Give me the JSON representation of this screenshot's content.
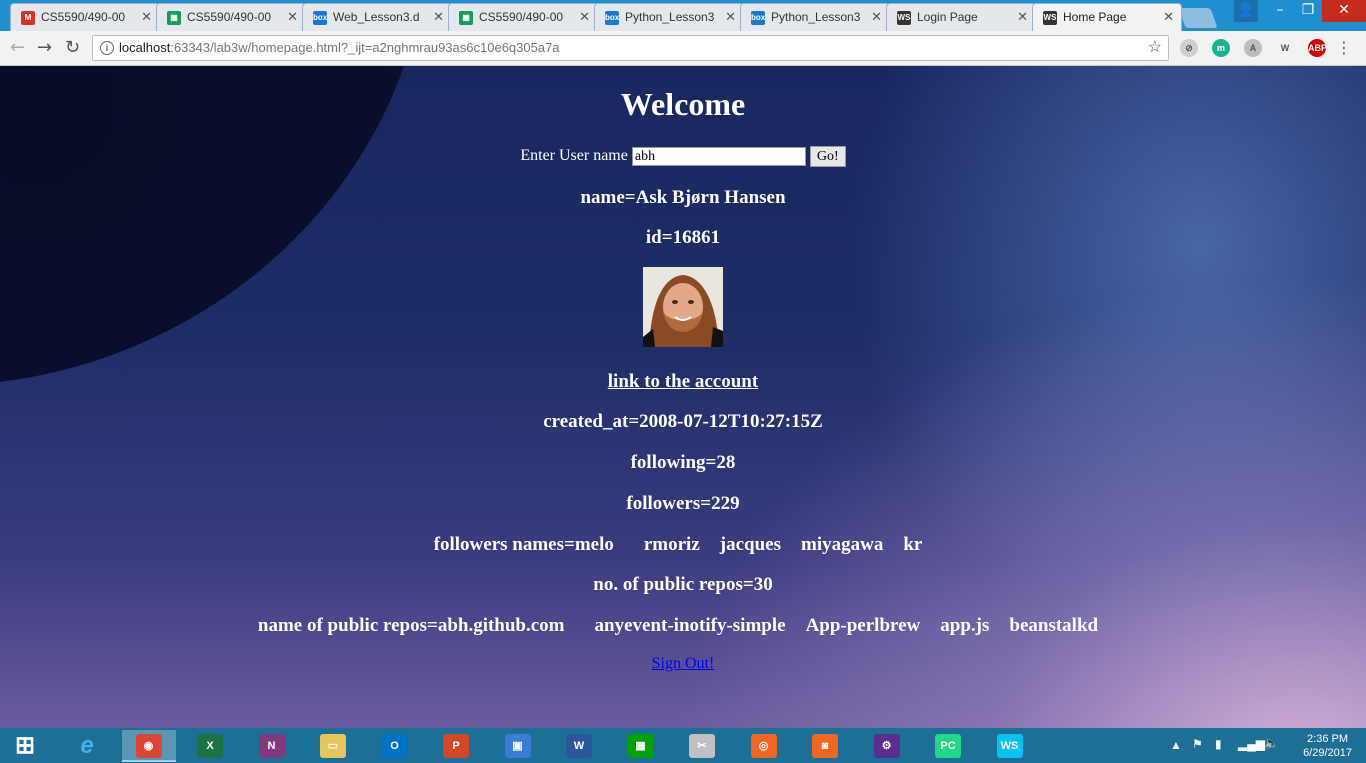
{
  "tabs": [
    {
      "title": "CS5590/490-00",
      "icon": "gmail-icon",
      "color": "#d93025",
      "glyph": "M"
    },
    {
      "title": "CS5590/490-00",
      "icon": "sheets-icon",
      "color": "#0f9d58",
      "glyph": "▦"
    },
    {
      "title": "Web_Lesson3.d",
      "icon": "box-icon",
      "color": "#1976d2",
      "glyph": "box"
    },
    {
      "title": "CS5590/490-00",
      "icon": "sheets-icon",
      "color": "#0f9d58",
      "glyph": "▦"
    },
    {
      "title": "Python_Lesson3",
      "icon": "box-icon",
      "color": "#1976d2",
      "glyph": "box"
    },
    {
      "title": "Python_Lesson3",
      "icon": "box-icon",
      "color": "#1976d2",
      "glyph": "box"
    },
    {
      "title": "Login Page",
      "icon": "webstorm-icon",
      "color": "#333333",
      "glyph": "WS"
    },
    {
      "title": "Home Page",
      "icon": "webstorm-icon",
      "color": "#333333",
      "glyph": "WS"
    }
  ],
  "address": {
    "host": "localhost",
    "path": ":63343/lab3w/homepage.html?_ijt=a2nghmrau93as6c10e6q305a7a"
  },
  "extensions": [
    {
      "name": "extension-grey-icon",
      "color": "#cfcfcf",
      "glyph": "⊘"
    },
    {
      "name": "extension-m-icon",
      "color": "#19b394",
      "glyph": "m"
    },
    {
      "name": "extension-translate-icon",
      "color": "#bdbdbd",
      "glyph": "A"
    },
    {
      "name": "extension-w-icon",
      "color": "#f2f2f2",
      "glyph": "W"
    },
    {
      "name": "adblock-icon",
      "color": "#d50000",
      "glyph": "ABP"
    }
  ],
  "page": {
    "heading": "Welcome",
    "user_label": "Enter User name",
    "user_value": "abh",
    "go_label": "Go!",
    "name_line": "name=Ask Bjørn Hansen",
    "id_line": "id=16861",
    "account_link": "link to the account",
    "created_line": "created_at=2008-07-12T10:27:15Z",
    "following_line": "following=28",
    "followers_line": "followers=229",
    "followers_names_prefix": "followers names=melo",
    "followers_names_rest": [
      "rmoriz",
      "jacques",
      "miyagawa",
      "kr"
    ],
    "repos_count_line": "no. of public repos=30",
    "repos_prefix": "name of public repos=abh.github.com",
    "repos_rest": [
      "anyevent-inotify-simple",
      "App-perlbrew",
      "app.js",
      "beanstalkd"
    ],
    "sign_out": "Sign Out!"
  },
  "taskbar": {
    "apps": [
      {
        "name": "start-button",
        "color": "transparent",
        "glyph": "⊞"
      },
      {
        "name": "internet-explorer-icon",
        "color": "transparent",
        "glyph": "e"
      },
      {
        "name": "chrome-icon",
        "color": "#db4437",
        "glyph": "◉"
      },
      {
        "name": "excel-icon",
        "color": "#1e7145",
        "glyph": "X"
      },
      {
        "name": "onenote-icon",
        "color": "#80397b",
        "glyph": "N"
      },
      {
        "name": "file-explorer-icon",
        "color": "#e8c45a",
        "glyph": "▭"
      },
      {
        "name": "outlook-icon",
        "color": "#0072c6",
        "glyph": "O"
      },
      {
        "name": "powerpoint-icon",
        "color": "#d24726",
        "glyph": "P"
      },
      {
        "name": "remote-desktop-icon",
        "color": "#3a7bd5",
        "glyph": "▣"
      },
      {
        "name": "word-icon",
        "color": "#2b579a",
        "glyph": "W"
      },
      {
        "name": "store-icon",
        "color": "#00a300",
        "glyph": "▦"
      },
      {
        "name": "snipping-tool-icon",
        "color": "#c0c0c0",
        "glyph": "✂"
      },
      {
        "name": "capture-icon",
        "color": "#f26522",
        "glyph": "◎"
      },
      {
        "name": "camera-icon",
        "color": "#f26522",
        "glyph": "◙"
      },
      {
        "name": "settings-app-icon",
        "color": "#5b2d90",
        "glyph": "⚙"
      },
      {
        "name": "pycharm-icon",
        "color": "#21d789",
        "glyph": "PC"
      },
      {
        "name": "webstorm-taskbar-icon",
        "color": "#07c3f2",
        "glyph": "WS"
      }
    ],
    "time": "2:36 PM",
    "date": "6/29/2017"
  }
}
